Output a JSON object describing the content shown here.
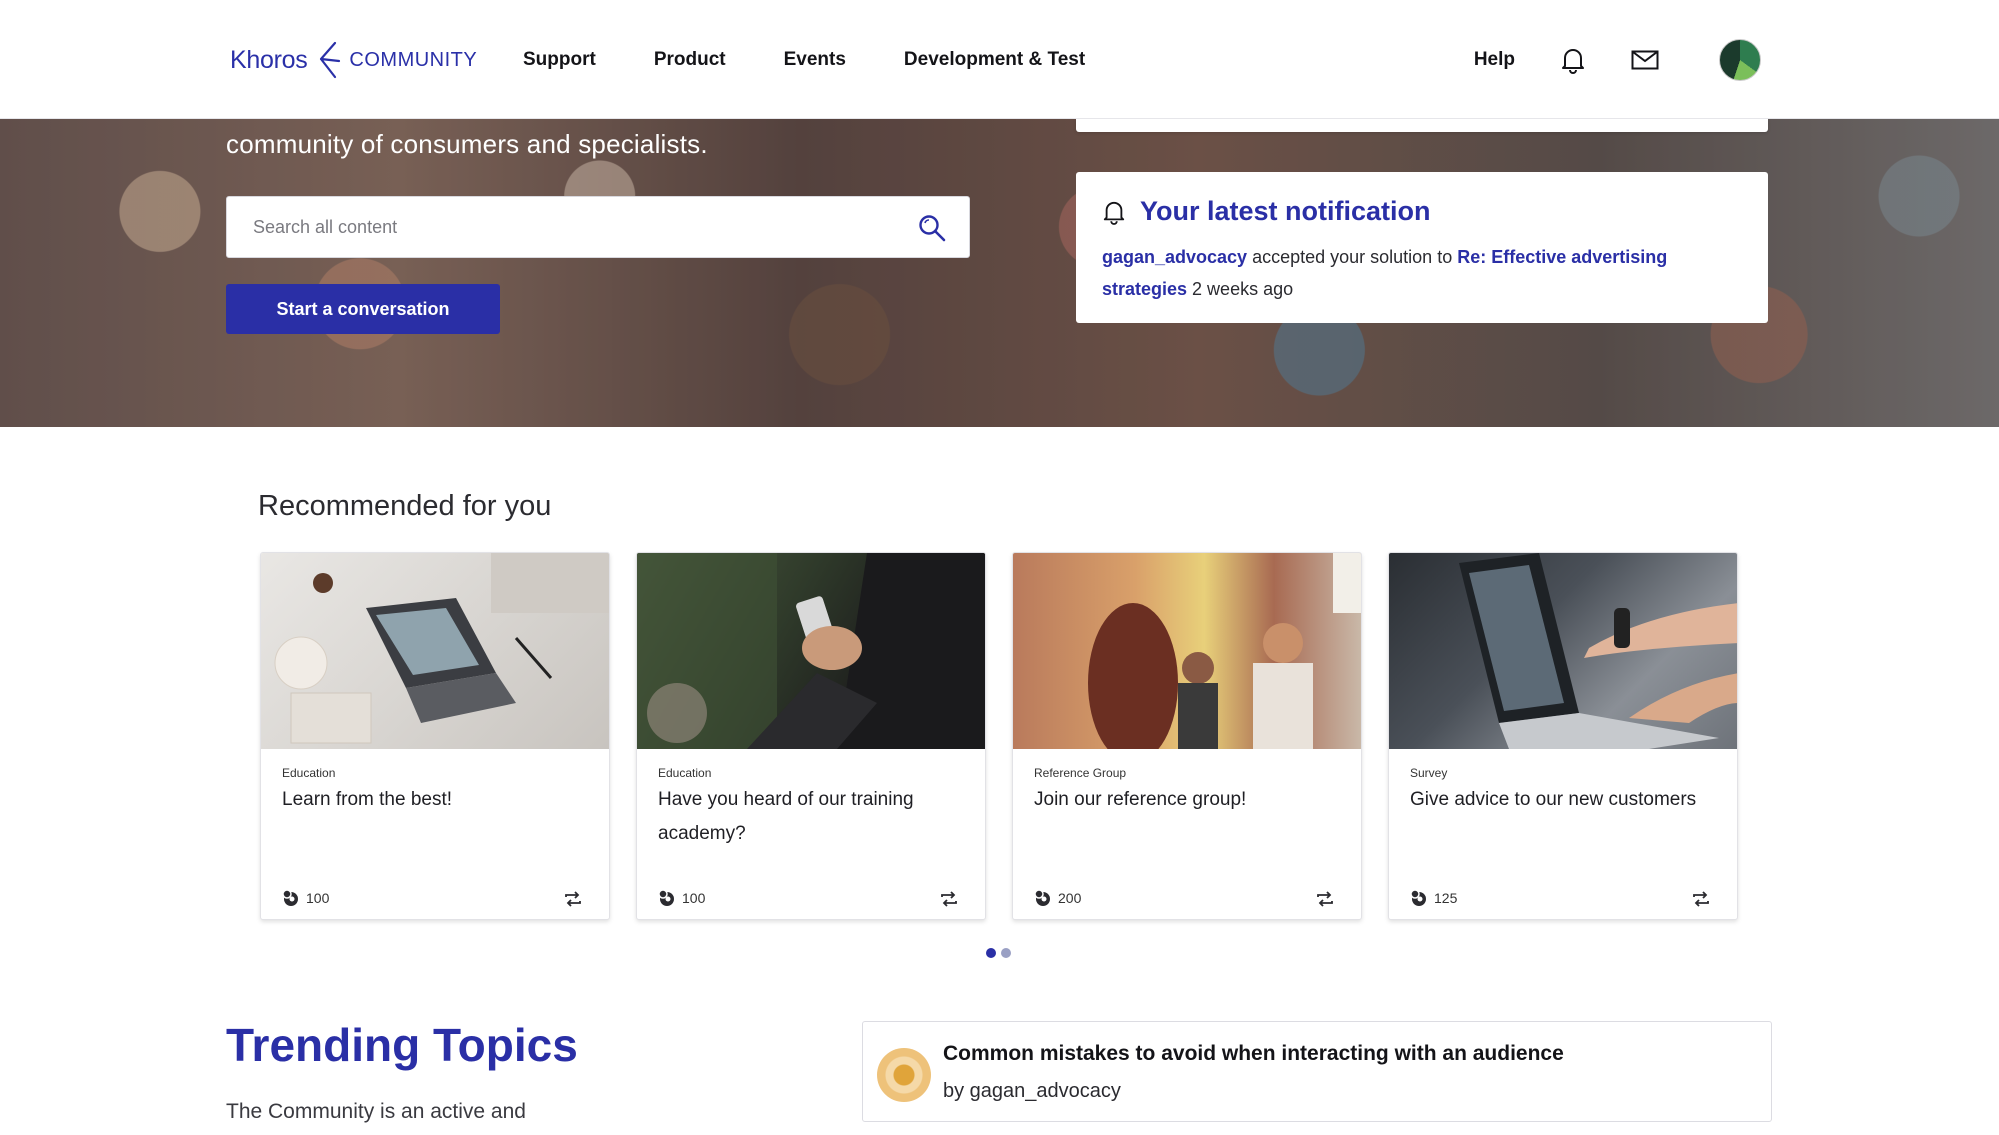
{
  "header": {
    "logo_brand": "Khoros",
    "logo_community": "COMMUNITY",
    "nav": [
      "Support",
      "Product",
      "Events",
      "Development & Test"
    ],
    "help": "Help"
  },
  "hero": {
    "tagline": "community of consumers and specialists.",
    "search_placeholder": "Search all content",
    "cta_label": "Start a conversation",
    "notification": {
      "title": "Your latest notification",
      "user": "gagan_advocacy",
      "action": " accepted your solution to ",
      "subject": "Re: Effective advertising strategies",
      "time": " 2 weeks ago"
    }
  },
  "recommended": {
    "title": "Recommended for you",
    "cards": [
      {
        "category": "Education",
        "title": "Learn from the best!",
        "points": "100"
      },
      {
        "category": "Education",
        "title": "Have you heard of our training academy?",
        "points": "100"
      },
      {
        "category": "Reference Group",
        "title": "Join our reference group!",
        "points": "200"
      },
      {
        "category": "Survey",
        "title": "Give advice to our new customers",
        "points": "125"
      }
    ]
  },
  "trending": {
    "title": "Trending Topics",
    "description": "The Community is an active and",
    "topic_title": "Common mistakes to avoid when interacting with an audience",
    "topic_by": "by gagan_advocacy"
  },
  "colors": {
    "accent": "#2a2fa6"
  }
}
